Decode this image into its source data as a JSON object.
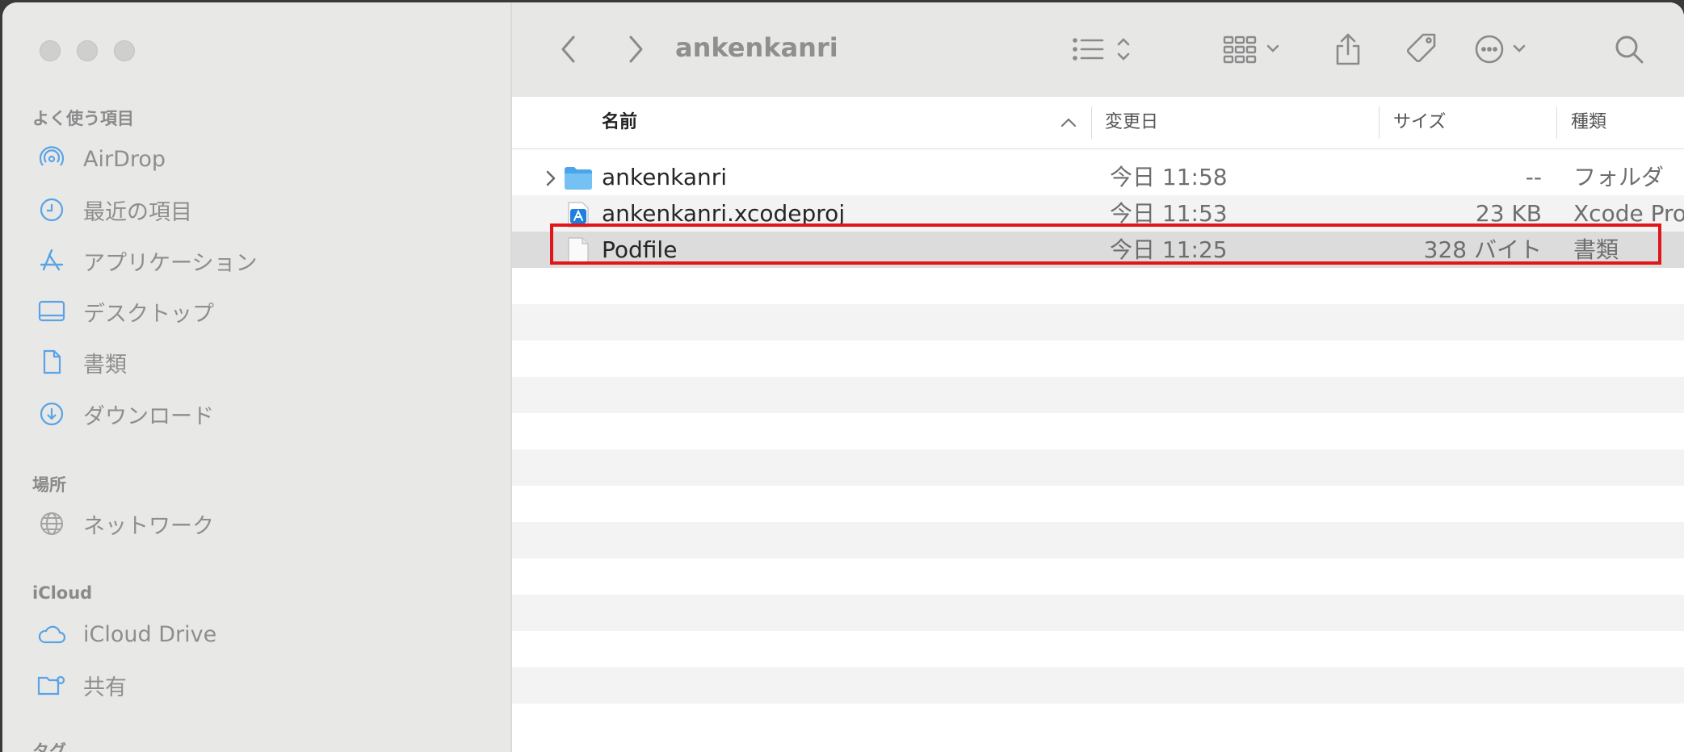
{
  "window": {
    "title": "ankenkanri"
  },
  "sidebar": {
    "sections": [
      {
        "title": "よく使う項目"
      },
      {
        "title": "場所"
      },
      {
        "title": "iCloud"
      },
      {
        "title": "タグ"
      }
    ],
    "favorites": [
      {
        "label": "AirDrop",
        "icon": "airdrop-icon"
      },
      {
        "label": "最近の項目",
        "icon": "clock-icon"
      },
      {
        "label": "アプリケーション",
        "icon": "applications-icon"
      },
      {
        "label": "デスクトップ",
        "icon": "desktop-icon"
      },
      {
        "label": "書類",
        "icon": "document-icon"
      },
      {
        "label": "ダウンロード",
        "icon": "download-icon"
      }
    ],
    "locations": [
      {
        "label": "ネットワーク",
        "icon": "network-globe-icon"
      }
    ],
    "icloud": [
      {
        "label": "iCloud Drive",
        "icon": "cloud-icon"
      },
      {
        "label": "共有",
        "icon": "shared-folder-icon"
      }
    ]
  },
  "columns": {
    "name": "名前",
    "modified": "変更日",
    "size": "サイズ",
    "kind": "種類"
  },
  "files": [
    {
      "name": "ankenkanri",
      "modified": "今日 11:58",
      "size": "--",
      "kind": "フォルダ",
      "icon": "folder-icon"
    },
    {
      "name": "ankenkanri.xcodeproj",
      "modified": "今日 11:53",
      "size": "23 KB",
      "kind": "Xcode Proj",
      "icon": "xcodeproj-icon"
    },
    {
      "name": "Podfile",
      "modified": "今日 11:25",
      "size": "328 バイト",
      "kind": "書類",
      "icon": "document-icon"
    }
  ],
  "colors": {
    "sidebar_bg": "#e8e8e7",
    "accent_icon": "#5aa3e6",
    "highlight": "#e0161b",
    "selected_row": "#dcdcdc"
  }
}
